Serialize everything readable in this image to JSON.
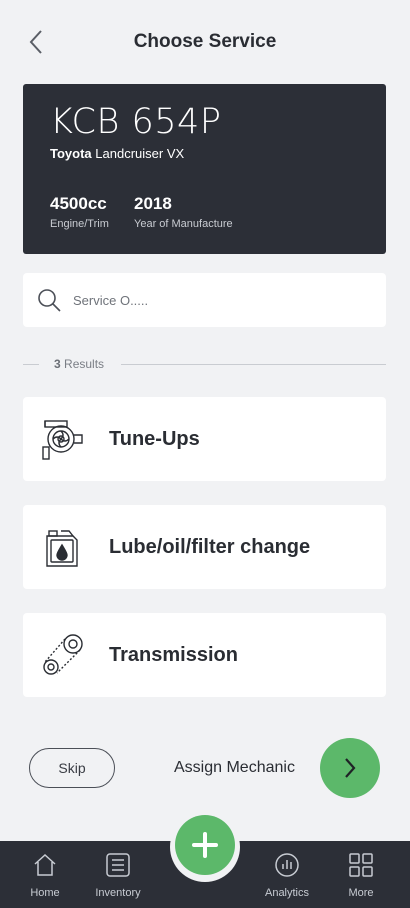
{
  "header": {
    "title": "Choose Service"
  },
  "vehicle": {
    "plate": "KCB 654P",
    "make": "Toyota",
    "model": "Landcruiser VX",
    "engine_value": "4500cc",
    "engine_label": "Engine/Trim",
    "year_value": "2018",
    "year_label": "Year of Manufacture"
  },
  "search": {
    "placeholder": "Service O....."
  },
  "results": {
    "count": "3",
    "label": "Results"
  },
  "services": [
    {
      "label": "Tune-Ups",
      "icon": "turbo-icon"
    },
    {
      "label": "Lube/oil/filter change",
      "icon": "oil-can-icon"
    },
    {
      "label": "Transmission",
      "icon": "timing-belt-icon"
    }
  ],
  "actions": {
    "skip": "Skip",
    "assign": "Assign Mechanic"
  },
  "nav": {
    "home": "Home",
    "inventory": "Inventory",
    "analytics": "Analytics",
    "more": "More"
  },
  "colors": {
    "accent": "#5cb86a",
    "dark": "#2c2f37",
    "background": "#f1f2f4"
  }
}
